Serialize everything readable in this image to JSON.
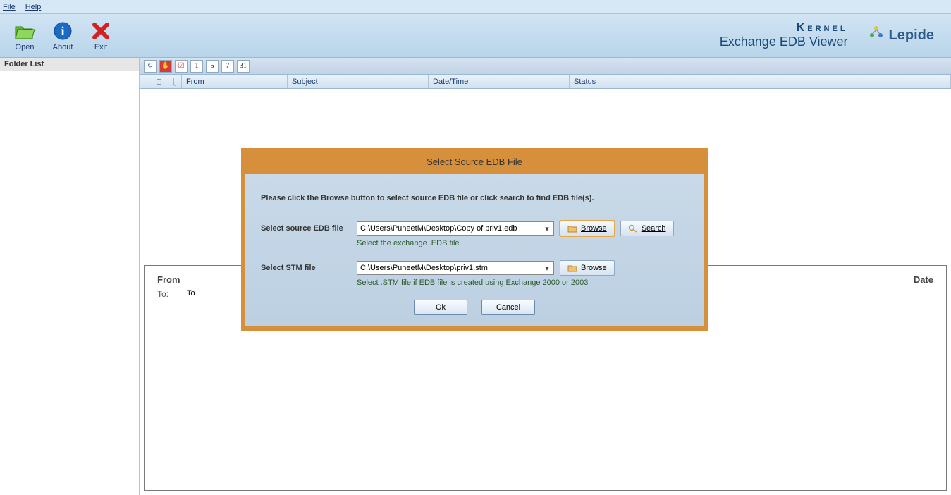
{
  "menu": {
    "file": "File",
    "help": "Help"
  },
  "toolbar": {
    "open": "Open",
    "about": "About",
    "exit": "Exit"
  },
  "brand": {
    "kernel": "Kernel",
    "product": "Exchange EDB Viewer",
    "company": "Lepide"
  },
  "sidebar": {
    "title": "Folder List"
  },
  "columns": {
    "from": "From",
    "subject": "Subject",
    "datetime": "Date/Time",
    "status": "Status"
  },
  "sub_buttons": [
    "1",
    "5",
    "7",
    "31"
  ],
  "preview": {
    "from_label": "From",
    "to_label": "To:",
    "to_value": "To",
    "date_label": "Date"
  },
  "dialog": {
    "title": "Select Source EDB File",
    "instruction": "Please click the Browse button to select source EDB file or click search to find EDB file(s).",
    "edb_label": "Select source EDB file",
    "edb_value": "C:\\Users\\PuneetM\\Desktop\\Copy of priv1.edb",
    "edb_hint": "Select the exchange .EDB file",
    "stm_label": "Select STM file",
    "stm_value": "C:\\Users\\PuneetM\\Desktop\\priv1.stm",
    "stm_hint": "Select .STM file if EDB file is created using Exchange 2000 or 2003",
    "browse": "Browse",
    "search": "Search",
    "ok": "Ok",
    "cancel": "Cancel"
  }
}
